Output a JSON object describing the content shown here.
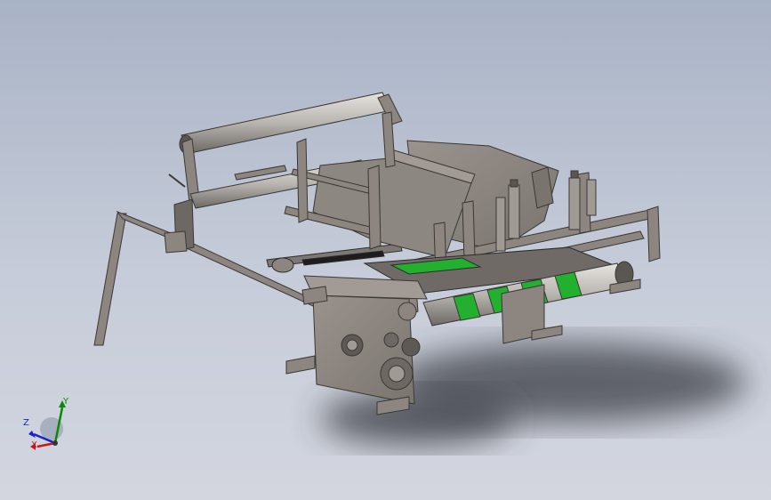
{
  "viewport": {
    "background_top": "#a9b3c6",
    "background_bottom": "#d3d6df"
  },
  "model": {
    "part_color": "#8c8580",
    "roller_color": "#b9b6b1",
    "belt_color": "#22b02e",
    "shadow_color": "#3a3d44"
  },
  "triad": {
    "x_label": "X",
    "y_label": "Y",
    "z_label": "Z",
    "x_color": "#c81818",
    "y_color": "#0a8a0a",
    "z_color": "#1a22c8"
  }
}
